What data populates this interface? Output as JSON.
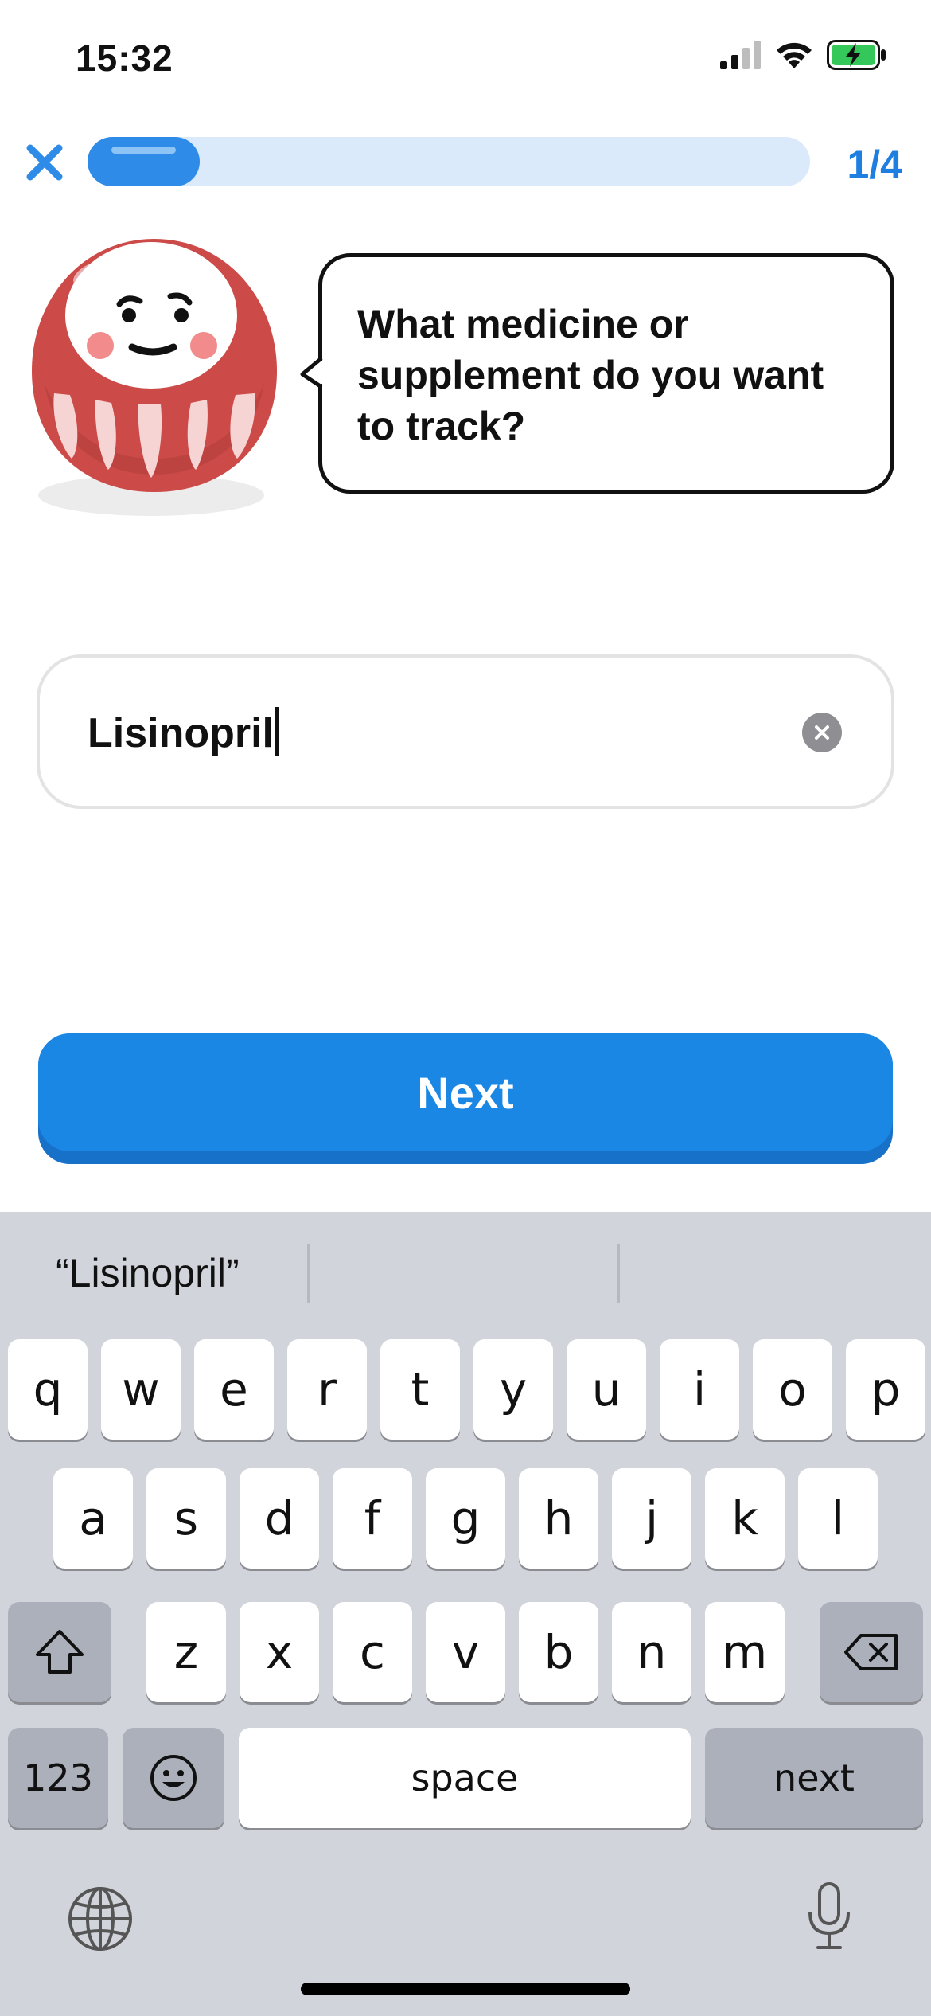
{
  "status": {
    "time": "15:32",
    "icons": [
      "cellular-signal-icon",
      "wifi-icon",
      "battery-charging-icon"
    ]
  },
  "progress": {
    "label": "1/4",
    "fraction": 0.25
  },
  "prompt": {
    "text": "What medicine or supplement do you want to track?"
  },
  "input": {
    "value": "Lisinopril"
  },
  "next_button": {
    "label": "Next"
  },
  "keyboard": {
    "suggestion": "“Lisinopril”",
    "row1": [
      "q",
      "w",
      "e",
      "r",
      "t",
      "y",
      "u",
      "i",
      "o",
      "p"
    ],
    "row2": [
      "a",
      "s",
      "d",
      "f",
      "g",
      "h",
      "j",
      "k",
      "l"
    ],
    "row3": [
      "z",
      "x",
      "c",
      "v",
      "b",
      "n",
      "m"
    ],
    "numbers_key": "123",
    "space_key": "space",
    "return_key": "next"
  },
  "colors": {
    "accent": "#1a87e5",
    "progress_track": "#dbeafb",
    "mascot_red": "#cc4a47"
  }
}
